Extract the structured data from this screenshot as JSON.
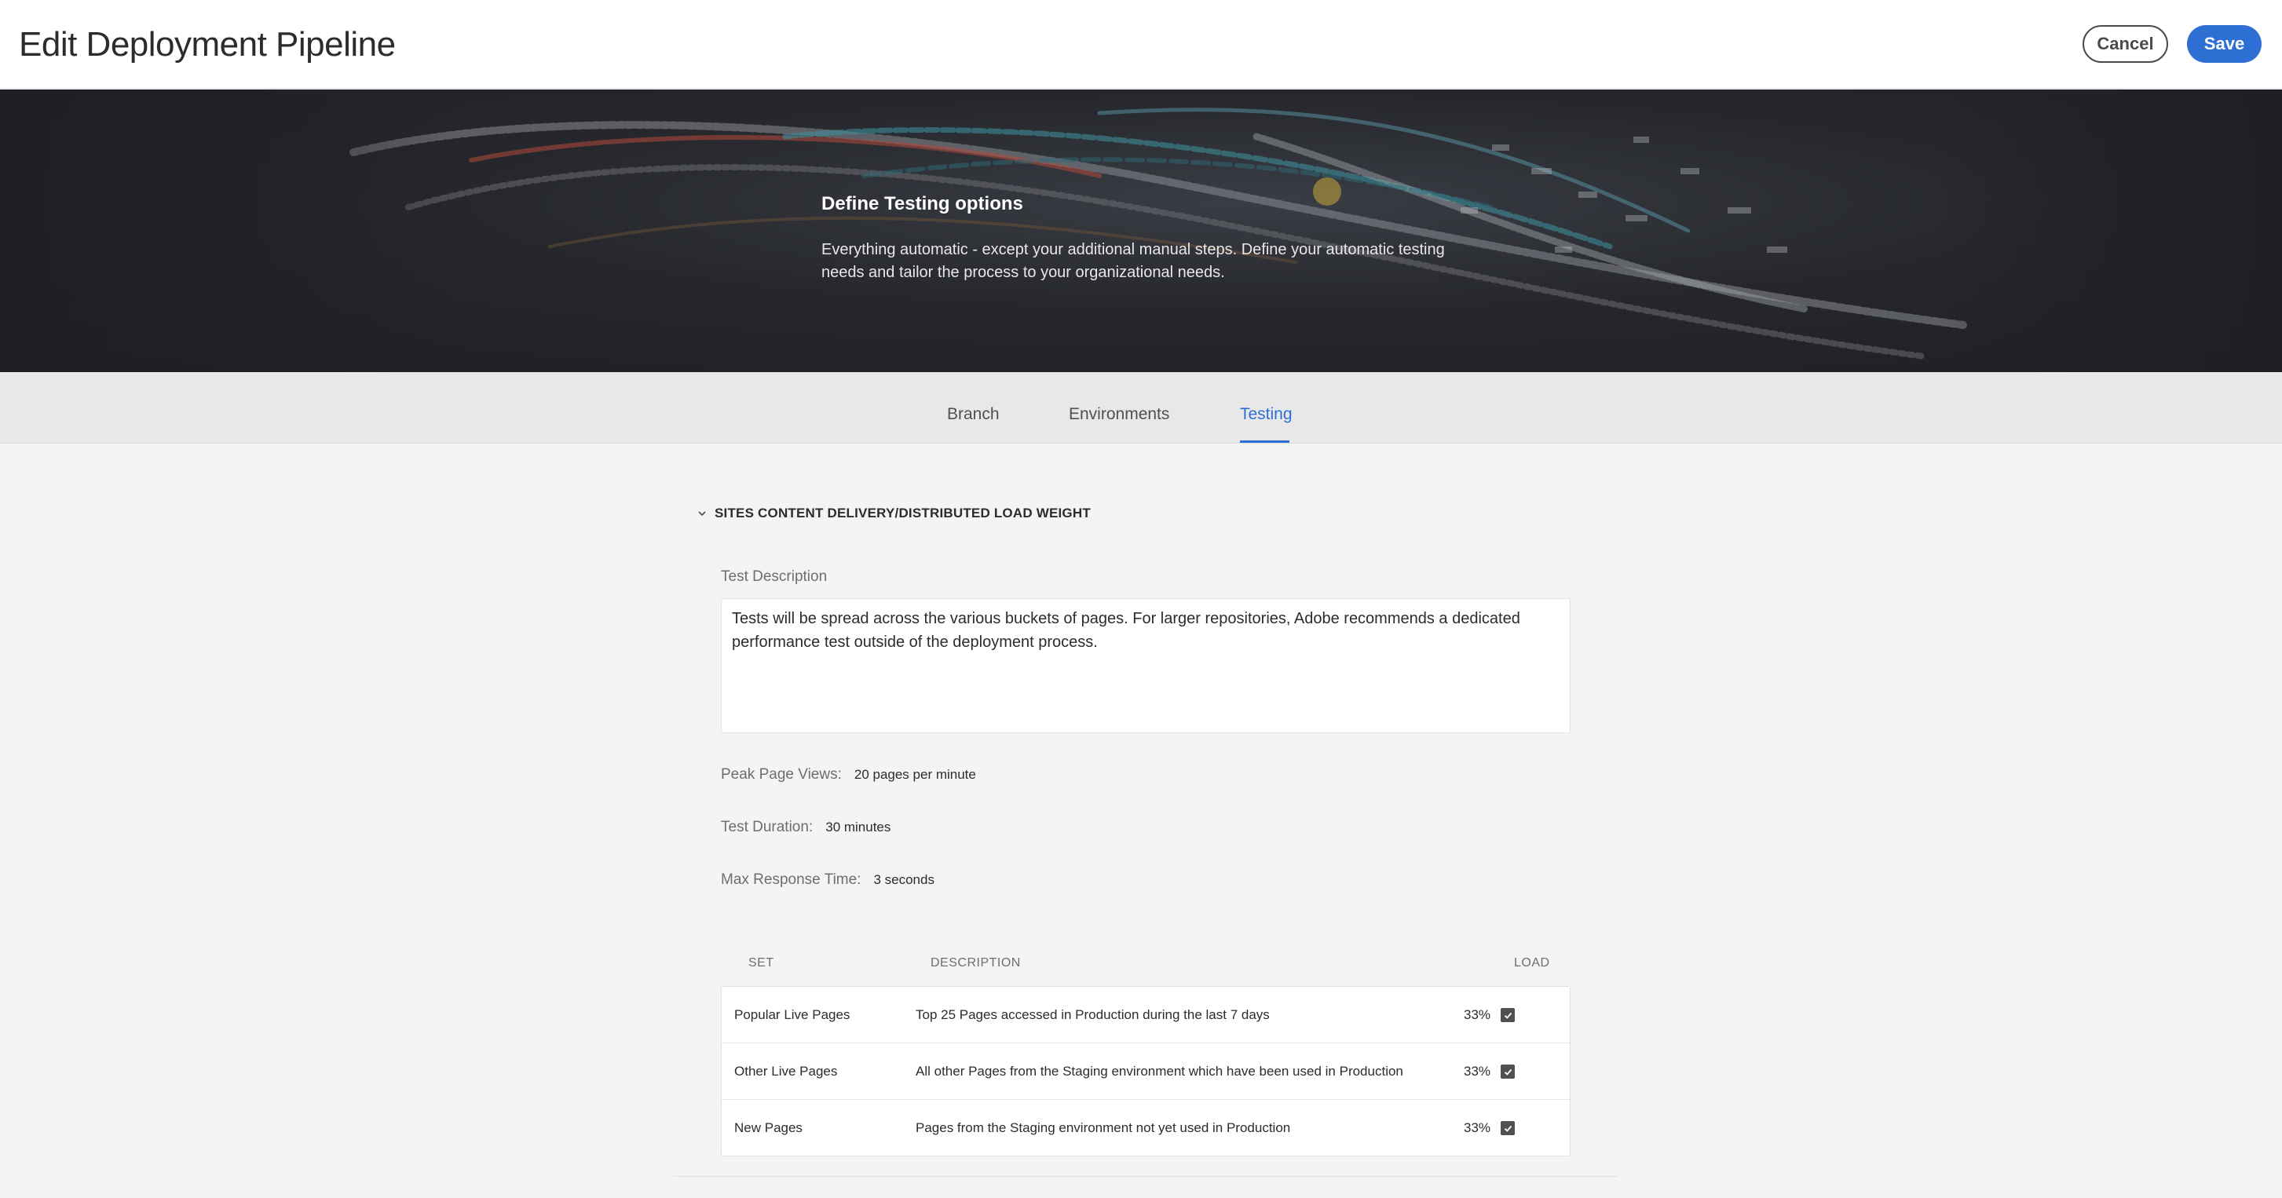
{
  "header": {
    "title": "Edit Deployment Pipeline",
    "cancel_label": "Cancel",
    "save_label": "Save"
  },
  "hero": {
    "title": "Define Testing options",
    "text": "Everything automatic - except your additional manual steps. Define your automatic testing needs and tailor the process to your organizational needs."
  },
  "tabs": [
    {
      "label": "Branch",
      "active": false
    },
    {
      "label": "Environments",
      "active": false
    },
    {
      "label": "Testing",
      "active": true
    }
  ],
  "section": {
    "title": "SITES CONTENT DELIVERY/DISTRIBUTED LOAD WEIGHT",
    "test_description_label": "Test Description",
    "test_description_value": "Tests will be spread across the various buckets of pages. For larger repositories, Adobe recommends a dedicated performance test outside of the deployment process.",
    "peak_page_views_label": "Peak Page Views:",
    "peak_page_views_value": "20 pages per minute",
    "test_duration_label": "Test Duration:",
    "test_duration_value": "30 minutes",
    "max_response_time_label": "Max Response Time:",
    "max_response_time_value": "3 seconds"
  },
  "table": {
    "headers": {
      "set": "SET",
      "description": "DESCRIPTION",
      "load": "LOAD"
    },
    "rows": [
      {
        "set": "Popular Live Pages",
        "description": "Top 25 Pages accessed in Production during the last 7 days",
        "load": "33%",
        "checked": true
      },
      {
        "set": "Other Live Pages",
        "description": "All other Pages from the Staging environment which have been used in Production",
        "load": "33%",
        "checked": true
      },
      {
        "set": "New Pages",
        "description": "Pages from the Staging environment not yet used in Production",
        "load": "33%",
        "checked": true
      }
    ]
  },
  "colors": {
    "accent": "#2d6fd3",
    "header_bg": "#ffffff",
    "tabbar_bg": "#e8e8e8",
    "page_bg": "#f4f4f4"
  },
  "icons": {
    "section_toggle": "chevron-down-icon",
    "checkbox": "checkmark-icon"
  }
}
